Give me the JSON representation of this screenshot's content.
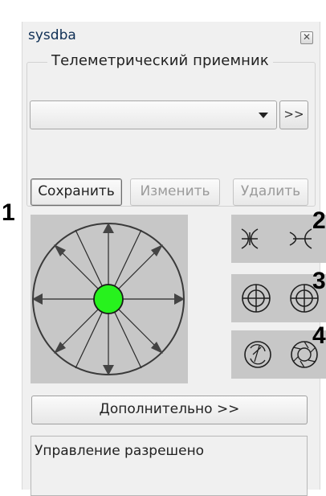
{
  "window": {
    "title": "sysdba",
    "close_glyph": "✕"
  },
  "receiver": {
    "group_label": "Телеметрический приемник",
    "selected_value": "",
    "more_label": ">>"
  },
  "actions": {
    "save": "Сохранить",
    "edit": "Изменить",
    "delete": "Удалить"
  },
  "markers": {
    "m1": "1",
    "m2": "2",
    "m3": "3",
    "m4": "4"
  },
  "controls": {
    "center_color": "#27f21d",
    "pad_color": "#c7c7c7",
    "icons": [
      "zoom-in-out-icon",
      "focus-icon",
      "iris-icon"
    ]
  },
  "advanced": {
    "label": "Дополнительно >>"
  },
  "status": {
    "text": "Управление разрешено"
  }
}
